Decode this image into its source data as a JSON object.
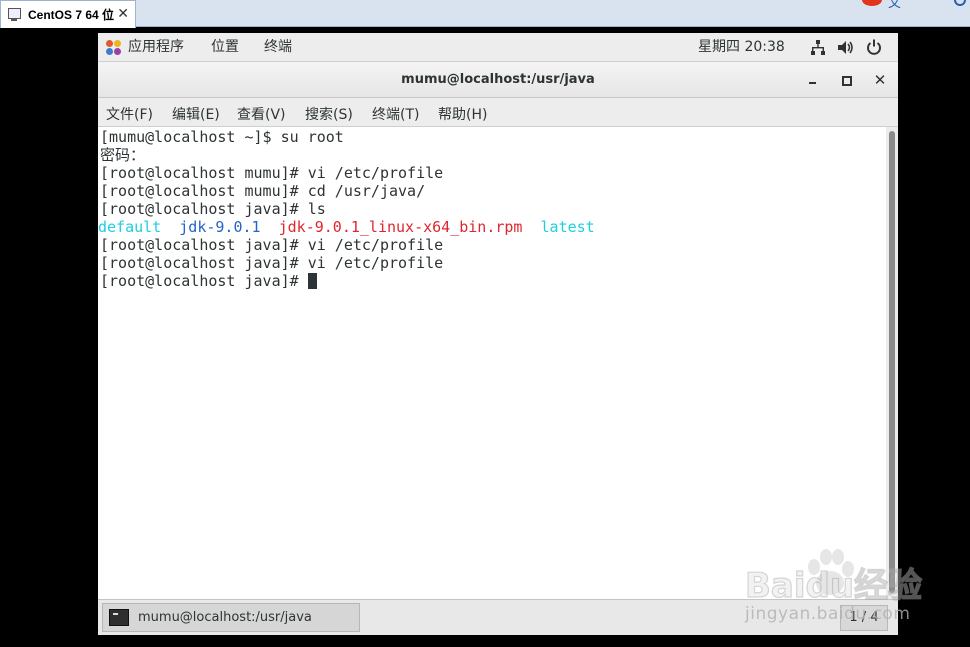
{
  "host": {
    "tab_title": "CentOS 7 64 位",
    "tab_close": "✕",
    "right_text": "文"
  },
  "panel": {
    "apps_label": "应用程序",
    "places_label": "位置",
    "terminal_label": "终端",
    "clock": "星期四 20:38",
    "icons": [
      "network-icon",
      "volume-icon",
      "power-icon"
    ]
  },
  "window": {
    "title": "mumu@localhost:/usr/java",
    "close_glyph": "✕"
  },
  "menu": {
    "items": [
      "文件(F)",
      "编辑(E)",
      "查看(V)",
      "搜索(S)",
      "终端(T)",
      "帮助(H)"
    ]
  },
  "terminal": {
    "lines": [
      "[mumu@localhost ~]$ su root",
      "密码：",
      "[root@localhost mumu]# vi /etc/profile",
      "[root@localhost mumu]# cd /usr/java/",
      "[root@localhost java]# ls"
    ],
    "ls_output": [
      {
        "name": "default",
        "color": "#1ecfe0"
      },
      {
        "name": "jdk-9.0.1",
        "color": "#2563c9"
      },
      {
        "name": "jdk-9.0.1_linux-x64_bin.rpm",
        "color": "#e0262f"
      },
      {
        "name": "latest",
        "color": "#1ecfe0"
      }
    ],
    "lines_after": [
      "[root@localhost java]# vi /etc/profile",
      "[root@localhost java]# vi /etc/profile",
      "[root@localhost java]# "
    ]
  },
  "taskbar": {
    "task_label": "mumu@localhost:/usr/java",
    "workspace": "1 / 4"
  },
  "watermark": {
    "brand": "Baidu经验",
    "domain": "jingyan.baidu.com"
  }
}
